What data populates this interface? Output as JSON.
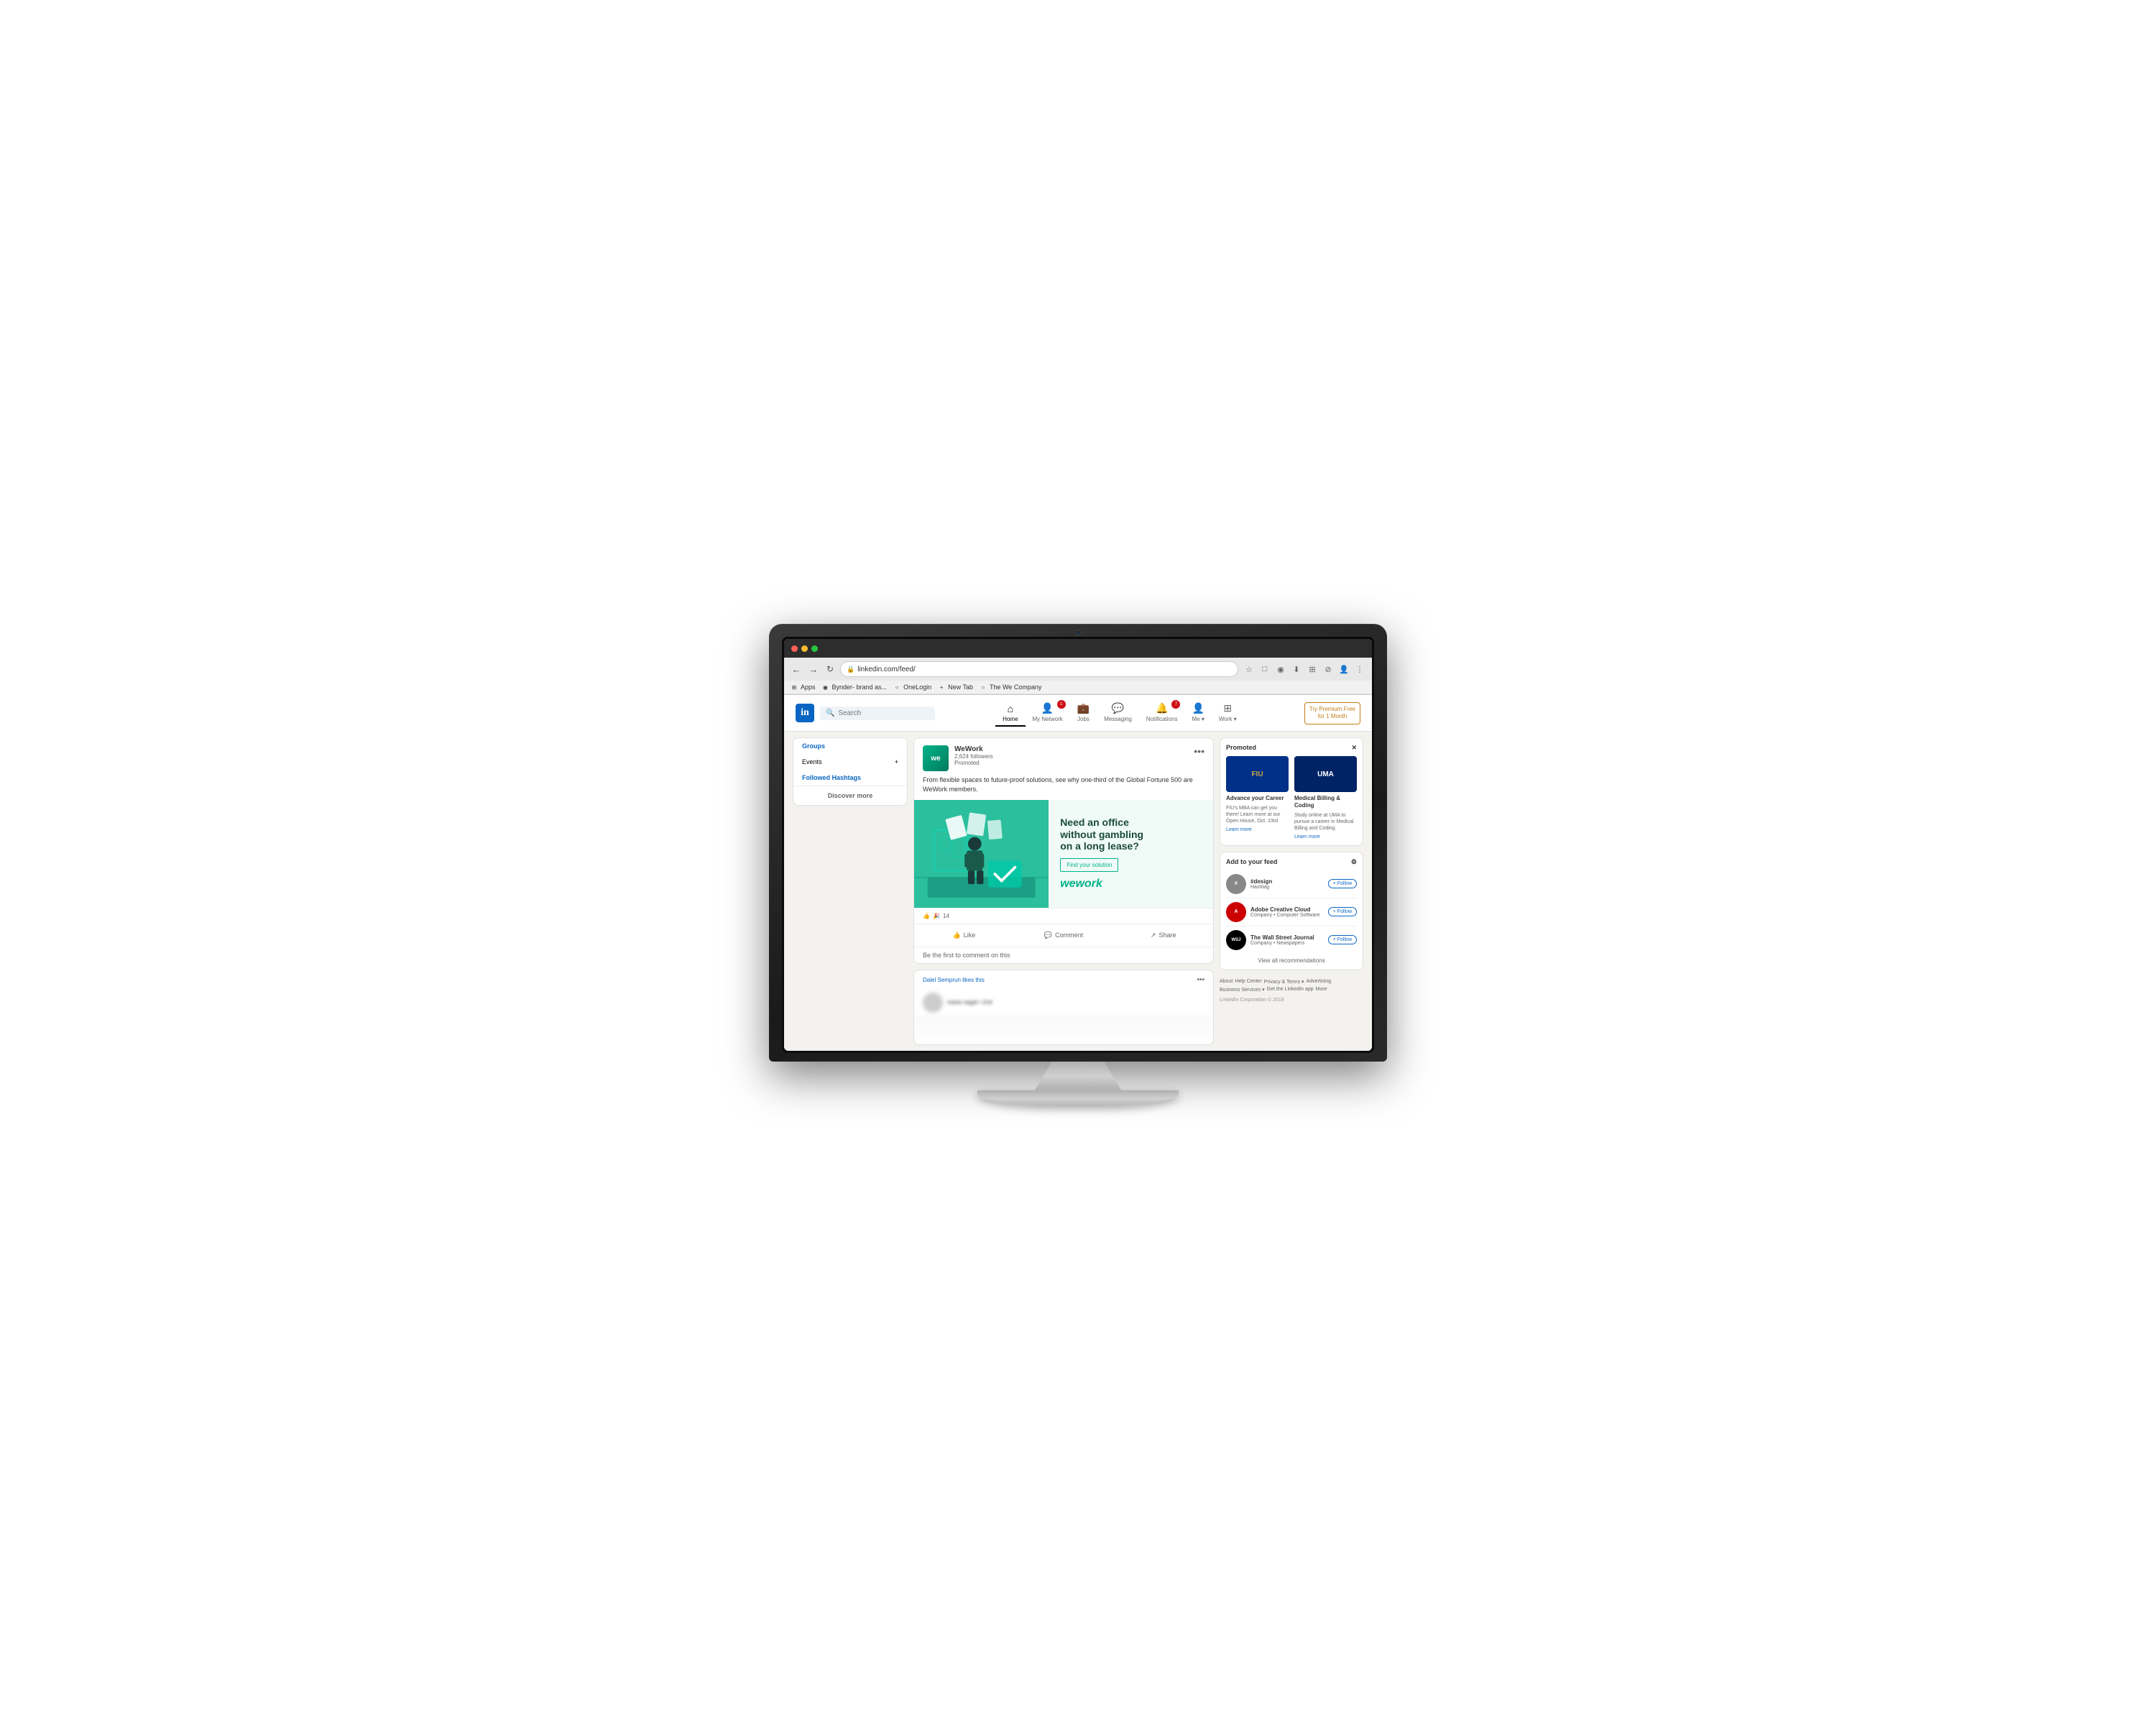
{
  "monitor": {
    "webcam_label": "webcam"
  },
  "browser": {
    "url": "linkedin.com/feed/",
    "back_label": "←",
    "forward_label": "→",
    "refresh_label": "↻",
    "traffic_lights": [
      "red",
      "yellow",
      "green"
    ],
    "bookmarks": [
      {
        "label": "Apps",
        "icon": "⊞"
      },
      {
        "label": "Bynder- brand as...",
        "icon": "◉"
      },
      {
        "label": "OneLogin",
        "icon": "○"
      },
      {
        "label": "New Tab",
        "icon": "+"
      },
      {
        "label": "The We Company",
        "icon": "○"
      }
    ]
  },
  "linkedin": {
    "logo": "in",
    "search_placeholder": "Search",
    "nav": [
      {
        "label": "Home",
        "icon": "⌂",
        "active": true,
        "badge": null
      },
      {
        "label": "My Network",
        "icon": "👤",
        "active": false,
        "badge": "1"
      },
      {
        "label": "Jobs",
        "icon": "💼",
        "active": false,
        "badge": null
      },
      {
        "label": "Messaging",
        "icon": "💬",
        "active": false,
        "badge": null
      },
      {
        "label": "Notifications",
        "icon": "🔔",
        "active": false,
        "badge": "7"
      },
      {
        "label": "Me",
        "icon": "👤",
        "active": false,
        "badge": null
      },
      {
        "label": "Work",
        "icon": "⊞",
        "active": false,
        "badge": null
      }
    ],
    "premium_cta_line1": "Try Premium Free",
    "premium_cta_line2": "for 1 Month",
    "left_sidebar": {
      "groups_label": "Groups",
      "events_label": "Events",
      "followed_hashtags_label": "Followed Hashtags",
      "discover_more_label": "Discover more"
    },
    "post": {
      "company": "WeWork",
      "followers": "2,624 followers",
      "promoted_label": "Promoted",
      "menu_icon": "•••",
      "body_text": "From flexible spaces to future-proof solutions, see why one-third of the Global Fortune 500 are WeWork members.",
      "ad_headline_line1": "Need an office",
      "ad_headline_line2": "without gambling",
      "ad_headline_line3": "on a long lease?",
      "find_solution_label": "Find your solution",
      "wework_brand": "wework",
      "reactions_count": "14",
      "like_label": "Like",
      "comment_label": "Comment",
      "share_label": "Share",
      "first_comment_prompt": "Be the first to comment on this"
    },
    "right_sidebar": {
      "promoted_label": "Promoted",
      "promoted_x": "✕",
      "ads": [
        {
          "name": "FIU",
          "title": "Advance your Career",
          "desc": "FIU's MBA can get you there! Learn more at our Open House, Oct. 23rd",
          "learn_more": "Learn more",
          "color": "#003087",
          "text_color": "#c8a84b"
        },
        {
          "name": "UMA",
          "title": "Medical Billing & Coding",
          "desc": "Study online at UMA to pursue a career in Medical Billing and Coding.",
          "learn_more": "Learn more",
          "color": "#002366",
          "text_color": "#fff"
        }
      ],
      "feed_section_title": "Add to your feed",
      "feed_section_icon": "⚙",
      "feed_items": [
        {
          "name": "#design",
          "desc": "Hashtag",
          "color": "#888",
          "follow_label": "+ Follow"
        },
        {
          "name": "Adobe Creative Cloud",
          "desc": "Company • Computer Software",
          "color": "#cc0000",
          "follow_label": "+ Follow"
        },
        {
          "name": "The Wall Street Journal",
          "desc": "Company • Newspapers",
          "color": "#000",
          "follow_label": "+ Follow"
        }
      ],
      "view_all_label": "View all recommendations",
      "footer_links": [
        "About",
        "Help Center",
        "Privacy & Terms ▾",
        "Advertising",
        "Business Services ▾",
        "Get the LinkedIn app",
        "More"
      ],
      "footer_copy": "LinkedIn Corporation © 2019"
    },
    "next_post_user": "Dalel Semprun likes this"
  }
}
